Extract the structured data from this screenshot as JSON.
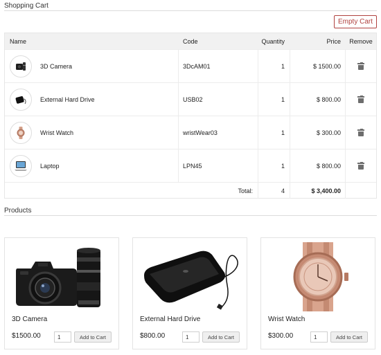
{
  "cart": {
    "title": "Shopping Cart",
    "empty_label": "Empty Cart",
    "columns": [
      "Name",
      "Code",
      "Quantity",
      "Price",
      "Remove"
    ],
    "items": [
      {
        "name": "3D Camera",
        "code": "3DcAM01",
        "qty": "1",
        "price": "$ 1500.00",
        "icon": "camera-icon"
      },
      {
        "name": "External Hard Drive",
        "code": "USB02",
        "qty": "1",
        "price": "$ 800.00",
        "icon": "hard-drive-icon"
      },
      {
        "name": "Wrist Watch",
        "code": "wristWear03",
        "qty": "1",
        "price": "$ 300.00",
        "icon": "watch-icon"
      },
      {
        "name": "Laptop",
        "code": "LPN45",
        "qty": "1",
        "price": "$ 800.00",
        "icon": "laptop-icon"
      }
    ],
    "total_label": "Total:",
    "total_qty": "4",
    "total_price": "$ 3,400.00"
  },
  "products": {
    "title": "Products",
    "add_label": "Add to Cart",
    "items": [
      {
        "name": "3D Camera",
        "price": "$1500.00",
        "qty": "1",
        "icon": "camera-icon"
      },
      {
        "name": "External Hard Drive",
        "price": "$800.00",
        "qty": "1",
        "icon": "hard-drive-icon"
      },
      {
        "name": "Wrist Watch",
        "price": "$300.00",
        "qty": "1",
        "icon": "watch-icon"
      }
    ]
  }
}
